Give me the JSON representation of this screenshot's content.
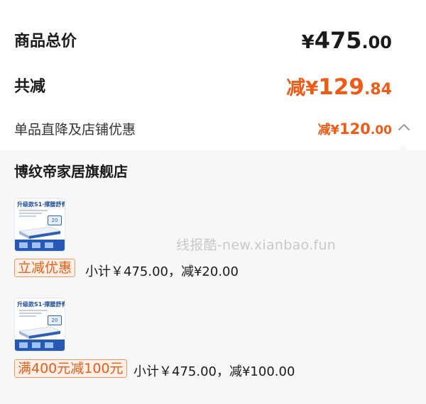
{
  "summary": {
    "total_label": "商品总价",
    "total_currency": "¥",
    "total_int": "475",
    "total_dec": ".00",
    "discount_label": "共减",
    "discount_prefix": "减",
    "discount_currency": "¥",
    "discount_int": "129",
    "discount_dec": ".84"
  },
  "detail": {
    "label": "单品直降及店铺优惠",
    "prefix": "减",
    "currency": "¥",
    "int": "120",
    "dec": ".00",
    "toggle_icon": "chevron-up-icon"
  },
  "store": {
    "name": "博纹帝家居旗舰店",
    "items": [
      {
        "thumb_title": "升级款S1·撑腰舒脊",
        "thumb_badge": "20",
        "promo": "立减优惠",
        "subtotal": "小计￥475.00，减¥20.00"
      },
      {
        "thumb_title": "升级款S1·撑腰舒脊",
        "thumb_badge": "20",
        "promo": "满400元减100元",
        "subtotal": "小计￥475.00，减¥100.00"
      }
    ]
  },
  "watermark": "线报酷-new.xianbao.fun",
  "colors": {
    "accent": "#f05a14",
    "promo_bg": "#fff1e8",
    "panel_bg": "#f7f7f7"
  }
}
